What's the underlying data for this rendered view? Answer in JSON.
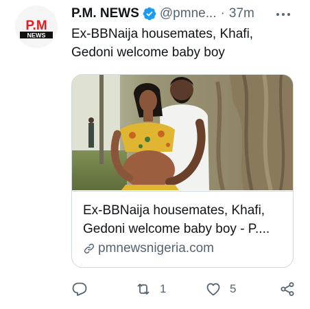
{
  "tweet": {
    "author": {
      "display_name": "P.M. NEWS",
      "handle": "@pmne...",
      "separator": "·",
      "time": "37m",
      "verified": true,
      "avatar_logo_top": "P.M",
      "avatar_logo_bottom": "NEWS",
      "brand_color": "#e31b23"
    },
    "text": "Ex-BBNaija housemates, Khafi, Gedoni welcome baby boy",
    "card": {
      "title": "Ex-BBNaija housemates, Khafi, Gedoni welcome baby boy - P....",
      "domain": "pmnewsnigeria.com",
      "image_description": "couple-photo"
    },
    "actions": {
      "reply_count": "",
      "retweet_count": "1",
      "like_count": "5"
    },
    "colors": {
      "text": "#0f1419",
      "secondary": "#536471",
      "verified": "#1d9bf0",
      "border": "#cfd9de"
    }
  }
}
